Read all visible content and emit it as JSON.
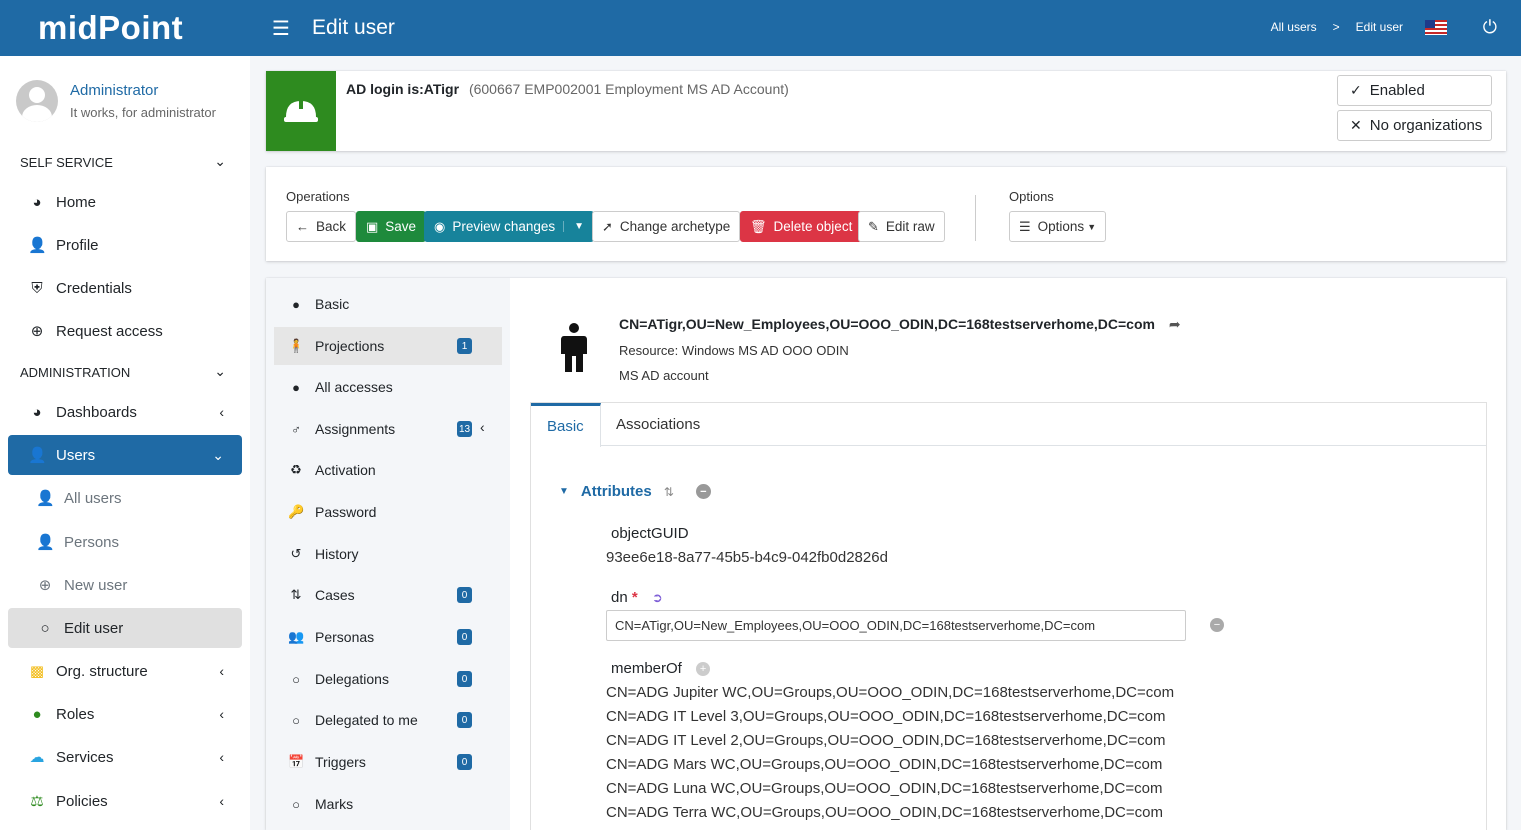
{
  "app": {
    "brand": "midPoint",
    "page_title": "Edit user"
  },
  "breadcrumbs": [
    "All users",
    ">",
    "Edit user"
  ],
  "user": {
    "name": "Administrator",
    "subtitle": "It works, for administrator"
  },
  "sidebar": {
    "self_service": "SELF SERVICE",
    "self_items": [
      {
        "label": "Home",
        "icon": "dashboard-icon"
      },
      {
        "label": "Profile",
        "icon": "user-icon"
      },
      {
        "label": "Credentials",
        "icon": "shield-icon"
      },
      {
        "label": "Request access",
        "icon": "plus-circle-icon"
      }
    ],
    "administration": "ADMINISTRATION",
    "admin_items": [
      {
        "label": "Dashboards"
      },
      {
        "label": "Users"
      },
      {
        "label": "All users"
      },
      {
        "label": "Persons"
      },
      {
        "label": "New user"
      },
      {
        "label": "Edit user"
      },
      {
        "label": "Org. structure"
      },
      {
        "label": "Roles"
      },
      {
        "label": "Services"
      },
      {
        "label": "Policies"
      }
    ]
  },
  "header": {
    "title_bold": "AD login is:ATigr",
    "title_desc": "(600667 EMP002001 Employment MS AD Account)",
    "enabled": "Enabled",
    "no_orgs": "No organizations",
    "archetype_color": "#2e8b1f"
  },
  "operations": {
    "label": "Operations",
    "back": "Back",
    "save": "Save",
    "preview": "Preview changes",
    "change_archetype": "Change archetype",
    "delete": "Delete object",
    "edit_raw": "Edit raw",
    "options_label": "Options",
    "options": "Options"
  },
  "menu": [
    {
      "label": "Basic",
      "badge": ""
    },
    {
      "label": "Projections",
      "badge": "1"
    },
    {
      "label": "All accesses",
      "badge": ""
    },
    {
      "label": "Assignments",
      "badge": "13"
    },
    {
      "label": "Activation",
      "badge": ""
    },
    {
      "label": "Password",
      "badge": ""
    },
    {
      "label": "History",
      "badge": ""
    },
    {
      "label": "Cases",
      "badge": "0"
    },
    {
      "label": "Personas",
      "badge": "0"
    },
    {
      "label": "Delegations",
      "badge": "0"
    },
    {
      "label": "Delegated to me",
      "badge": "0"
    },
    {
      "label": "Triggers",
      "badge": "0"
    },
    {
      "label": "Marks",
      "badge": ""
    }
  ],
  "shadow": {
    "dn_title": "CN=ATigr,OU=New_Employees,OU=OOO_ODIN,DC=168testserverhome,DC=com",
    "resource": "Resource: Windows MS AD OOO ODIN",
    "kind": "MS AD account"
  },
  "tabs": [
    "Basic",
    "Associations"
  ],
  "attributes": {
    "header": "Attributes",
    "objectGUID_label": "objectGUID",
    "objectGUID_value": "93ee6e18-8a77-45b5-b4c9-042fb0d2826d",
    "dn_label": "dn",
    "dn_required": "*",
    "dn_value": "CN=ATigr,OU=New_Employees,OU=OOO_ODIN,DC=168testserverhome,DC=com",
    "memberOf_label": "memberOf",
    "memberOf": [
      "CN=ADG Jupiter WC,OU=Groups,OU=OOO_ODIN,DC=168testserverhome,DC=com",
      "CN=ADG IT Level 3,OU=Groups,OU=OOO_ODIN,DC=168testserverhome,DC=com",
      "CN=ADG IT Level 2,OU=Groups,OU=OOO_ODIN,DC=168testserverhome,DC=com",
      "CN=ADG Mars WC,OU=Groups,OU=OOO_ODIN,DC=168testserverhome,DC=com",
      "CN=ADG Luna WC,OU=Groups,OU=OOO_ODIN,DC=168testserverhome,DC=com",
      "CN=ADG Terra WC,OU=Groups,OU=OOO_ODIN,DC=168testserverhome,DC=com"
    ]
  },
  "colors": {
    "primary": "#1f6aa5",
    "save": "#1e8a3c",
    "preview": "#17839b",
    "delete": "#dc3545"
  }
}
